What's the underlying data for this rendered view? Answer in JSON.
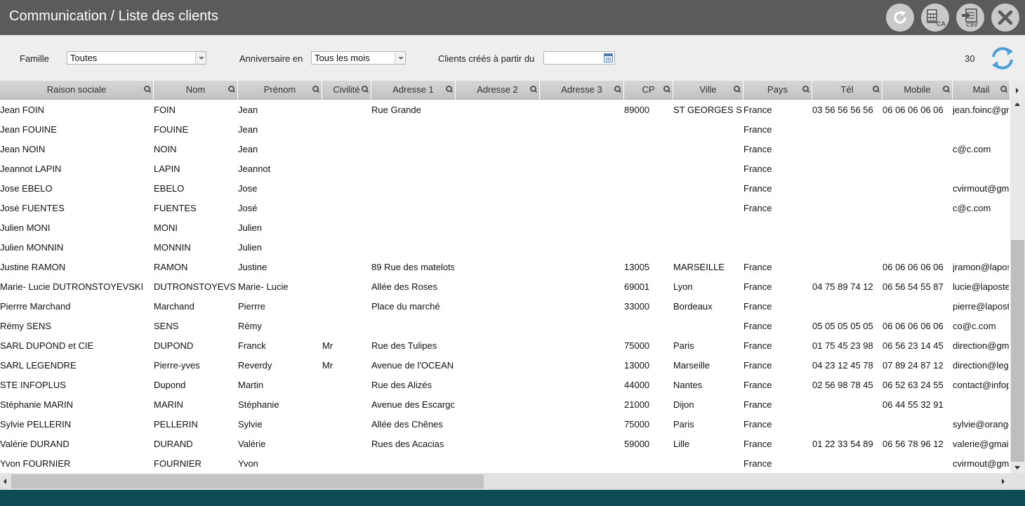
{
  "header": {
    "title": "Communication / Liste des clients",
    "buttons": [
      {
        "name": "refresh",
        "icon": "refresh-icon",
        "label": ""
      },
      {
        "name": "calculator",
        "icon": "calculator-icon",
        "label": "CA"
      },
      {
        "name": "export",
        "icon": "export-icon",
        "label": "CSV"
      },
      {
        "name": "close",
        "icon": "close-icon",
        "label": ""
      }
    ]
  },
  "filters": {
    "famille_label": "Famille",
    "famille_value": "Toutes",
    "anniversaire_label": "Anniversaire en",
    "anniversaire_value": "Tous les mois",
    "crees_label": "Clients créés à partir du",
    "crees_value": "",
    "count": "30",
    "refresh_icon": "refresh-icon",
    "accent_color": "#4a9fd8"
  },
  "table": {
    "columns": [
      "Raison sociale",
      "Nom",
      "Prénom",
      "Civilité",
      "Adresse 1",
      "Adresse 2",
      "Adresse 3",
      "CP",
      "Ville",
      "Pays",
      "Tél",
      "Mobile",
      "Mail"
    ],
    "rows": [
      [
        "Jean FOIN",
        "FOIN",
        "Jean",
        "",
        "Rue Grande",
        "",
        "",
        "89000",
        "ST GEORGES S",
        "France",
        "03 56 56 56 56",
        "06 06 06 06 06",
        "jean.foinc@gm"
      ],
      [
        "Jean FOUINE",
        "FOUINE",
        "Jean",
        "",
        "",
        "",
        "",
        "",
        "",
        "France",
        "",
        "",
        ""
      ],
      [
        "Jean NOIN",
        "NOIN",
        "Jean",
        "",
        "",
        "",
        "",
        "",
        "",
        "France",
        "",
        "",
        "c@c.com"
      ],
      [
        "Jeannot LAPIN",
        "LAPIN",
        "Jeannot",
        "",
        "",
        "",
        "",
        "",
        "",
        "France",
        "",
        "",
        ""
      ],
      [
        "Jose EBELO",
        "EBELO",
        "Jose",
        "",
        "",
        "",
        "",
        "",
        "",
        "France",
        "",
        "",
        "cvirmout@gma"
      ],
      [
        "José FUENTES",
        "FUENTES",
        "José",
        "",
        "",
        "",
        "",
        "",
        "",
        "France",
        "",
        "",
        "c@c.com"
      ],
      [
        "Julien MONI",
        "MONI",
        "Julien",
        "",
        "",
        "",
        "",
        "",
        "",
        "",
        "",
        "",
        ""
      ],
      [
        "Julien MONNIN",
        "MONNIN",
        "Julien",
        "",
        "",
        "",
        "",
        "",
        "",
        "",
        "",
        "",
        ""
      ],
      [
        "Justine RAMON",
        "RAMON",
        "Justine",
        "",
        "89 Rue des matelots",
        "",
        "",
        "13005",
        "MARSEILLE",
        "France",
        "",
        "06 06 06 06 06",
        "jramon@lapos"
      ],
      [
        "Marie- Lucie DUTRONSTOYEVSKI",
        "DUTRONSTOYEVS",
        "Marie- Lucie",
        "",
        "Allée des Roses",
        "",
        "",
        "69001",
        "Lyon",
        "France",
        "04 75 89 74 12",
        "06 56 54 55 87",
        "lucie@laposte"
      ],
      [
        "Pierrre Marchand",
        "Marchand",
        "Pierrre",
        "",
        "Place du marché",
        "",
        "",
        "33000",
        "Bordeaux",
        "France",
        "",
        "",
        "pierre@lapost"
      ],
      [
        "Rémy SENS",
        "SENS",
        "Rémy",
        "",
        "",
        "",
        "",
        "",
        "",
        "France",
        "05 05 05 05 05",
        "06 06 06 06 06",
        "co@c.com"
      ],
      [
        "SARL DUPOND et CIE",
        "DUPOND",
        "Franck",
        "Mr",
        "Rue des Tulipes",
        "",
        "",
        "75000",
        "Paris",
        "France",
        "01 75 45 23 98",
        "06 56 23 14 45",
        "direction@gm"
      ],
      [
        "SARL LEGENDRE",
        "Pierre-yves",
        "Reverdy",
        "Mr",
        "Avenue de l'OCEAN",
        "",
        "",
        "13000",
        "Marseille",
        "France",
        "04 23 12 45 78",
        "07 89 24 87 12",
        "direction@lege"
      ],
      [
        "STE INFOPLUS",
        "Dupond",
        "Martin",
        "",
        "Rue des Alizés",
        "",
        "",
        "44000",
        "Nantes",
        "France",
        "02 56 98 78 45",
        "06 52 63 24 55",
        "contact@infop"
      ],
      [
        "Stéphanie MARIN",
        "MARIN",
        "Stéphanie",
        "",
        "Avenue des Escargots",
        "",
        "",
        "21000",
        "Dijon",
        "France",
        "",
        "06 44 55 32 91",
        ""
      ],
      [
        "Sylvie PELLERIN",
        "PELLERIN",
        "Sylvie",
        "",
        "Allée des Chênes",
        "",
        "",
        "75000",
        "Paris",
        "France",
        "",
        "",
        "sylvie@orange"
      ],
      [
        "Valérie DURAND",
        "DURAND",
        "Valérie",
        "",
        "Rues des Acacias",
        "",
        "",
        "59000",
        "Lille",
        "France",
        "01 22 33 54 89",
        "06 56 78 96 12",
        "valerie@gmail"
      ],
      [
        "Yvon FOURNIER",
        "FOURNIER",
        "Yvon",
        "",
        "",
        "",
        "",
        "",
        "",
        "France",
        "",
        "",
        "cvirmout@gma"
      ]
    ]
  },
  "colors": {
    "header_bg": "#5b5b5b",
    "filter_bg": "#eeeeee",
    "footer_bg": "#0f4a57"
  }
}
